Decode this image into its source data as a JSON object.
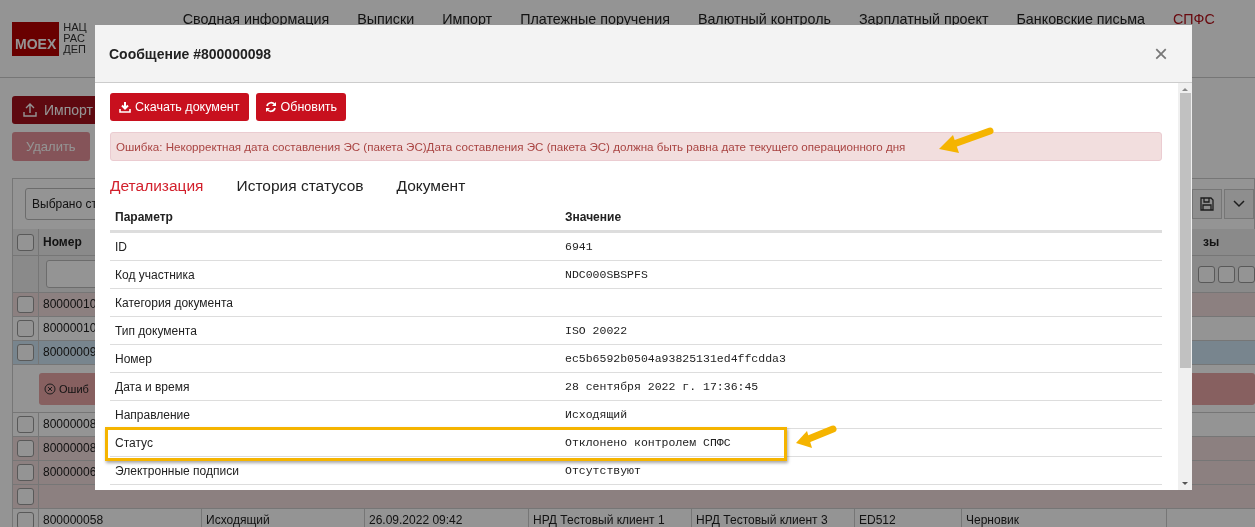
{
  "header": {
    "logo": "MOEX",
    "logo_lines": [
      "НАЦ",
      "РАС",
      "ДЕП"
    ],
    "nav": [
      {
        "label": "Сводная информация",
        "selected": false
      },
      {
        "label": "Выписки",
        "selected": false
      },
      {
        "label": "Импорт",
        "selected": false
      },
      {
        "label": "Платежные поручения",
        "selected": false
      },
      {
        "label": "Валютный контроль",
        "selected": false
      },
      {
        "label": "Зарплатный проект",
        "selected": false
      },
      {
        "label": "Банковские письма",
        "selected": false
      },
      {
        "label": "СПФС",
        "selected": true
      }
    ]
  },
  "toolbar": {
    "import_button": "Импорт",
    "delete_button": {
      "label": "Удалить",
      "disabled": true
    },
    "select": "Выбрано ст"
  },
  "table": {
    "column_1": "Номер",
    "column_last": "зы",
    "header_checked": false,
    "filter_checks": [
      false,
      false,
      false
    ],
    "rows": [
      {
        "kind": "row",
        "rejected": true,
        "selected": false,
        "cells": [
          "80000010"
        ]
      },
      {
        "kind": "row",
        "rejected": false,
        "selected": false,
        "cells": [
          "80000010"
        ]
      },
      {
        "kind": "row",
        "selected": true,
        "cells": [
          "80000009"
        ]
      },
      {
        "kind": "error",
        "text": "Ошиб"
      },
      {
        "kind": "row",
        "rejected": false,
        "selected": false,
        "cells": [
          "80000008"
        ]
      },
      {
        "kind": "row",
        "rejected": true,
        "selected": false,
        "cells": [
          "80000008"
        ]
      },
      {
        "kind": "row",
        "rejected": true,
        "selected": false,
        "cells": [
          "80000006"
        ]
      },
      {
        "kind": "row",
        "rejected": true,
        "selected": false
      },
      {
        "kind": "row",
        "rejected": false,
        "selected": false,
        "cells": [
          "800000058",
          "Исходящий",
          "26.09.2022 09:42",
          "НРД Тестовый клиент 1",
          "НРД Тестовый клиент 3",
          "ED512",
          "Черновик"
        ]
      }
    ]
  },
  "modal": {
    "title": "Сообщение #800000098",
    "close": "×",
    "buttons": [
      {
        "kind": "download",
        "label": "Скачать документ"
      },
      {
        "kind": "refresh",
        "label": "Обновить"
      }
    ],
    "alert": "Ошибка: Некорректная дата составления ЭС (пакета ЭС)Дата составления ЭС (пакета ЭС) должна быть равна дате текущего операционного дня",
    "tabs": [
      {
        "label": "Детализация",
        "selected": true
      },
      {
        "label": "История статусов",
        "selected": false
      },
      {
        "label": "Документ",
        "selected": false
      }
    ],
    "columns": [
      "Параметр",
      "Значение"
    ],
    "rows": [
      {
        "param": "ID",
        "value": "6941",
        "highlighted": false
      },
      {
        "param": "Код участника",
        "value": "NDC000SBSPFS",
        "highlighted": false
      },
      {
        "param": "Категория документа",
        "highlighted": false
      },
      {
        "param": "Тип документа",
        "value": "ISO 20022",
        "highlighted": false
      },
      {
        "param": "Номер",
        "value": "ec5b6592b0504a93825131ed4ffcdda3",
        "highlighted": false
      },
      {
        "param": "Дата и время",
        "value": "28 сентября 2022 г. 17:36:45",
        "highlighted": false
      },
      {
        "param": "Направление",
        "value": "Исходящий",
        "highlighted": false
      },
      {
        "param": "Статус",
        "value": "Отклонено контролем СПФС",
        "highlighted": true
      },
      {
        "param": "Электронные подписи",
        "value": "Отсутствуют",
        "highlighted": false
      }
    ]
  }
}
